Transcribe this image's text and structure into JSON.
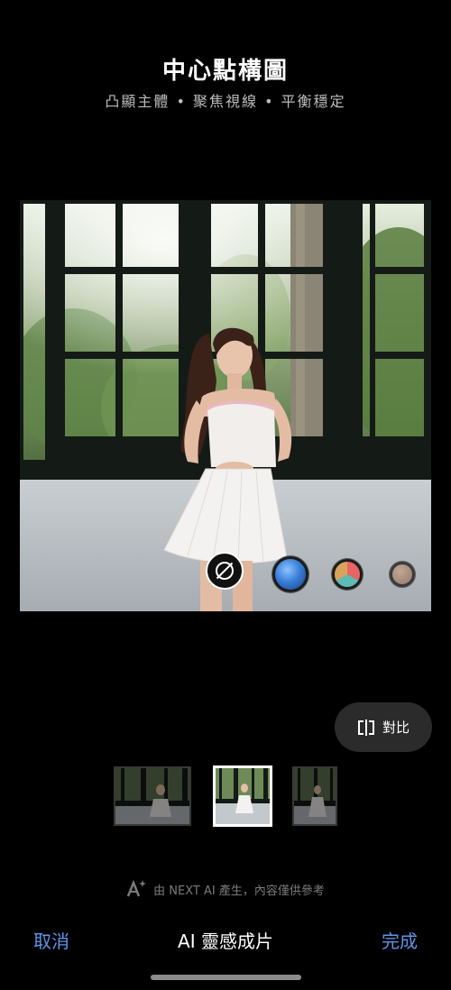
{
  "header": {
    "title": "中心點構圖",
    "subtitle": "凸顯主體 • 聚焦視線 • 平衡穩定"
  },
  "photo": {
    "description_icon": "photo-preview",
    "filters": [
      {
        "name": "none",
        "icon": "no-filter-icon"
      },
      {
        "name": "blue",
        "color": "#3a7fd9"
      },
      {
        "name": "multicolor",
        "color": "#e76464"
      },
      {
        "name": "muted",
        "color": "#8c6a58"
      }
    ]
  },
  "compare": {
    "label": "對比",
    "icon": "compare-icon"
  },
  "thumbnails": {
    "count": 3,
    "selected_index": 1
  },
  "ai_note": {
    "text": "由 NEXT AI 產生，內容僅供參考",
    "icon": "ai-sparkle-icon"
  },
  "bottom_bar": {
    "cancel_label": "取消",
    "title": "AI 靈感成片",
    "done_label": "完成"
  },
  "colors": {
    "accent": "#5e95e8",
    "background": "#000000",
    "compare_bg": "#2b2b2b"
  }
}
